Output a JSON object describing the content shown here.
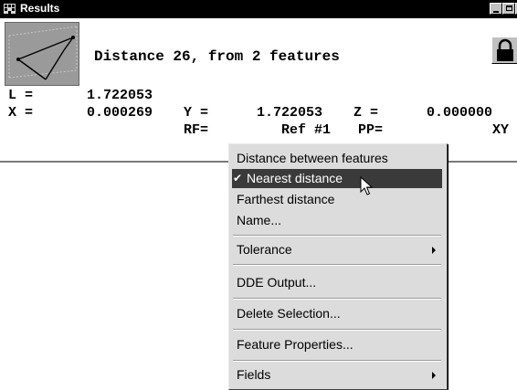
{
  "window": {
    "title": "Results",
    "heading": "Distance 26, from 2 features"
  },
  "results": {
    "L_label": "L =",
    "L_value": "1.722053",
    "X_label": "X =",
    "X_value": "0.000269",
    "Y_label": "Y =",
    "Y_value": "1.722053",
    "Z_label": "Z =",
    "Z_value": "0.000000",
    "RF_label": "RF=",
    "RF_value": "Ref #1",
    "PP_label": "PP=",
    "PP_value": "XY"
  },
  "menu": {
    "items": [
      {
        "label": "Distance between features"
      },
      {
        "label": "Nearest distance",
        "checked": true,
        "selected": true
      },
      {
        "label": "Farthest distance"
      },
      {
        "label": "Name...",
        "mnemonic": "N"
      },
      {
        "label": "Tolerance",
        "mnemonic": "T",
        "submenu": true
      },
      {
        "label": "DDE Output...",
        "mnemonic": "p"
      },
      {
        "label": "Delete Selection...",
        "mnemonic": "D"
      },
      {
        "label": "Feature Properties...",
        "mnemonic": "F"
      },
      {
        "label": "Fields",
        "mnemonic": "l",
        "submenu": true
      }
    ],
    "check_glyph": "✔"
  },
  "colors": {
    "titlebar": "#000000",
    "menu_bg": "#dcdcdc",
    "selection": "#3a3a3a"
  }
}
